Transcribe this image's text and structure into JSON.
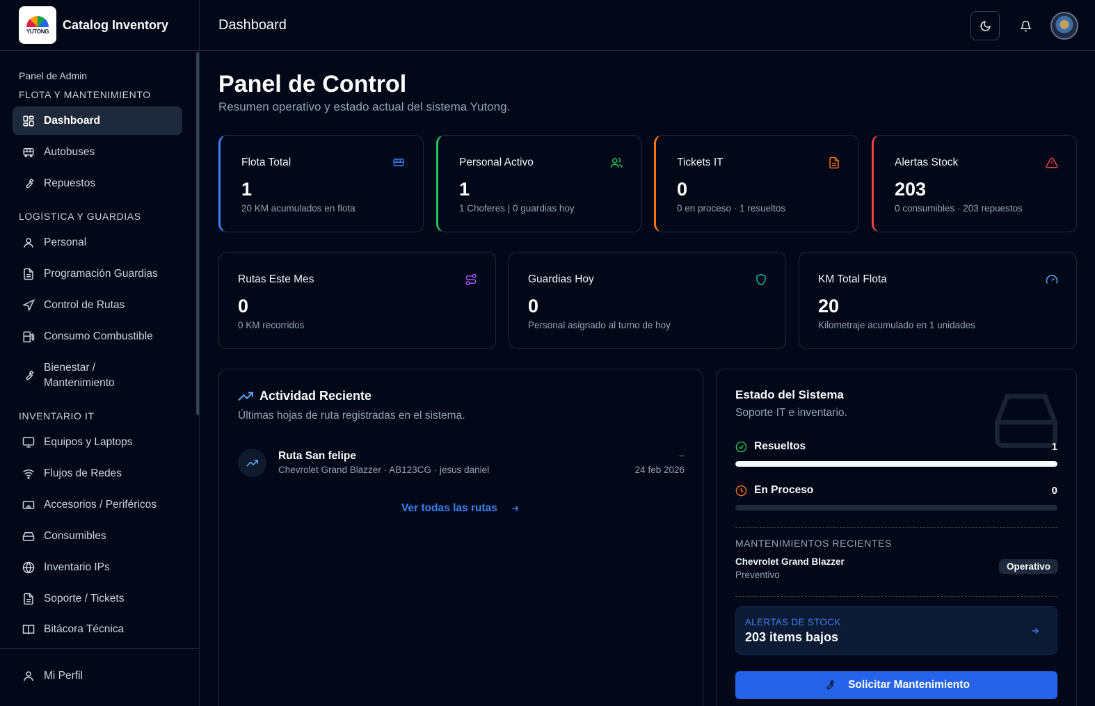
{
  "app": {
    "title": "Catalog Inventory",
    "logo_text": "YUTONG"
  },
  "topbar": {
    "page_name": "Dashboard",
    "theme_icon": "moon-icon",
    "bell_icon": "bell-icon"
  },
  "sidebar": {
    "caption": "Panel de Admin",
    "sections": [
      {
        "title": "FLOTA Y MANTENIMIENTO",
        "items": [
          {
            "label": "Dashboard",
            "icon": "dashboard-icon",
            "active": true
          },
          {
            "label": "Autobuses",
            "icon": "bus-icon"
          },
          {
            "label": "Repuestos",
            "icon": "wrench-icon"
          }
        ]
      },
      {
        "title": "LOGÍSTICA Y GUARDIAS",
        "items": [
          {
            "label": "Personal",
            "icon": "user-icon"
          },
          {
            "label": "Programación Guardias",
            "icon": "document-icon"
          },
          {
            "label": "Control de Rutas",
            "icon": "navigation-icon"
          },
          {
            "label": "Consumo Combustible",
            "icon": "fuel-icon"
          },
          {
            "label": "Bienestar / Mantenimiento",
            "icon": "wrench-icon"
          }
        ]
      },
      {
        "title": "INVENTARIO IT",
        "items": [
          {
            "label": "Equipos y Laptops",
            "icon": "monitor-icon"
          },
          {
            "label": "Flujos de Redes",
            "icon": "wifi-icon"
          },
          {
            "label": "Accesorios / Periféricos",
            "icon": "keyboard-icon"
          },
          {
            "label": "Consumibles",
            "icon": "drive-icon"
          },
          {
            "label": "Inventario IPs",
            "icon": "globe-icon"
          },
          {
            "label": "Soporte / Tickets",
            "icon": "document-icon"
          },
          {
            "label": "Bitácora Técnica",
            "icon": "book-icon"
          }
        ]
      }
    ],
    "footer": {
      "label": "Mi Perfil",
      "icon": "user-icon"
    }
  },
  "header": {
    "title": "Panel de Control",
    "subtitle": "Resumen operativo y estado actual del sistema Yutong."
  },
  "stats_top": [
    {
      "label": "Flota Total",
      "value": "1",
      "desc": "20 KM acumulados en flota",
      "icon": "bus-icon",
      "accent": "#3b82f6"
    },
    {
      "label": "Personal Activo",
      "value": "1",
      "desc": "1 Choferes | 0 guardias hoy",
      "icon": "users-icon",
      "accent": "#22c55e"
    },
    {
      "label": "Tickets IT",
      "value": "0",
      "desc": "0 en proceso · 1 resueltos",
      "icon": "file-icon",
      "accent": "#f97316"
    },
    {
      "label": "Alertas Stock",
      "value": "203",
      "desc": "0 consumibles · 203 repuestos",
      "icon": "alert-triangle-icon",
      "accent": "#ef4444"
    }
  ],
  "stats_bottom": [
    {
      "label": "Rutas Este Mes",
      "value": "0",
      "desc": "0 KM recorridos",
      "icon": "route-icon",
      "accent": "#a855f7"
    },
    {
      "label": "Guardias Hoy",
      "value": "0",
      "desc": "Personal asignado al turno de hoy",
      "icon": "shield-icon",
      "accent": "#14b8a6"
    },
    {
      "label": "KM Total Flota",
      "value": "20",
      "desc": "Kilometraje acumulado en 1 unidades",
      "icon": "gauge-icon",
      "accent": "#60a5fa"
    }
  ],
  "activity": {
    "title": "Actividad Reciente",
    "subtitle": "Últimas hojas de ruta registradas en el sistema.",
    "items": [
      {
        "name": "Ruta San felipe",
        "meta": "Chevrolet Grand Blazzer · AB123CG · jesus daniel",
        "extra": "–",
        "date": "24 feb 2026"
      }
    ],
    "view_all": "Ver todas las rutas"
  },
  "system": {
    "title": "Estado del Sistema",
    "subtitle": "Soporte IT e inventario.",
    "resolved": {
      "label": "Resueltos",
      "value": "1",
      "fraction": 1.0
    },
    "in_progress": {
      "label": "En Proceso",
      "value": "0",
      "fraction": 0.0
    },
    "maintenance_head": "MANTENIMIENTOS RECIENTES",
    "maintenance": {
      "vehicle": "Chevrolet Grand Blazzer",
      "type": "Preventivo",
      "status": "Operativo"
    },
    "stock": {
      "head": "ALERTAS DE STOCK",
      "value": "203 items bajos"
    },
    "request_button": "Solicitar Mantenimiento"
  }
}
